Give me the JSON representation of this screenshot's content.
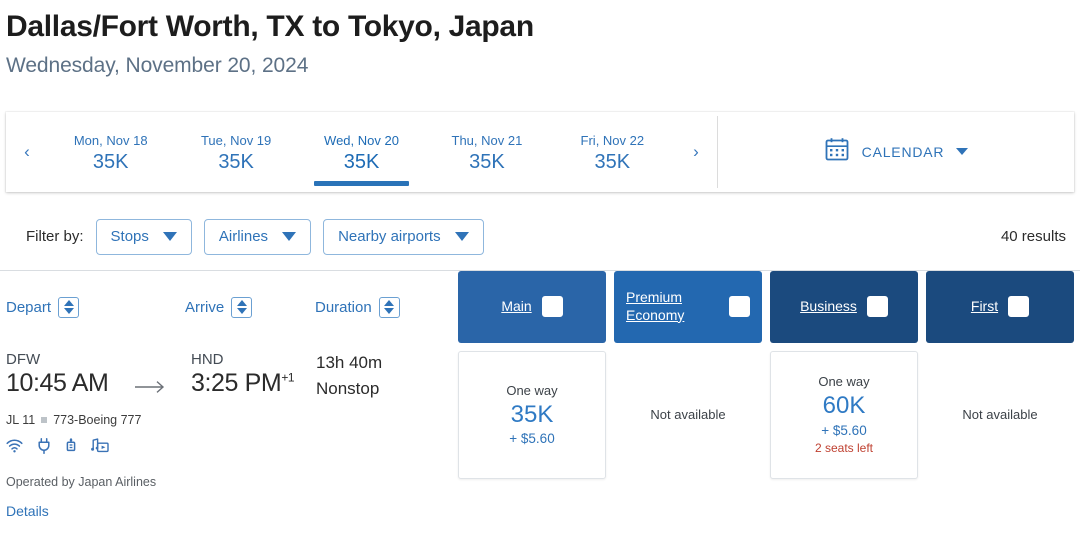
{
  "header": {
    "title": "Dallas/Fort Worth, TX to Tokyo, Japan",
    "subtitle": "Wednesday, November 20, 2024"
  },
  "datebar": {
    "prev_icon": "chevron-left-icon",
    "next_icon": "chevron-right-icon",
    "prev_glyph": "‹",
    "next_glyph": "›",
    "dates": [
      {
        "label": "Mon, Nov 18",
        "price": "35K",
        "selected": false
      },
      {
        "label": "Tue, Nov 19",
        "price": "35K",
        "selected": false
      },
      {
        "label": "Wed, Nov 20",
        "price": "35K",
        "selected": true
      },
      {
        "label": "Thu, Nov 21",
        "price": "35K",
        "selected": false
      },
      {
        "label": "Fri, Nov 22",
        "price": "35K",
        "selected": false
      }
    ],
    "calendar_label": "CALENDAR",
    "calendar_icon": "calendar-icon"
  },
  "filters": {
    "label": "Filter by:",
    "buttons": [
      {
        "label": "Stops"
      },
      {
        "label": "Airlines"
      },
      {
        "label": "Nearby airports"
      }
    ],
    "results": "40 results"
  },
  "columns": {
    "depart": "Depart",
    "arrive": "Arrive",
    "duration": "Duration"
  },
  "cabins": [
    {
      "label": "Main",
      "sort": "both",
      "color": "#2a65a8"
    },
    {
      "label": "Premium Economy",
      "sort": "both",
      "color": "#2368b0"
    },
    {
      "label": "Business",
      "sort": "down",
      "color": "#1b4a7e"
    },
    {
      "label": "First",
      "sort": "both",
      "color": "#1b4a7e"
    }
  ],
  "flight": {
    "depart_code": "DFW",
    "depart_time": "10:45 AM",
    "arrive_code": "HND",
    "arrive_time": "3:25 PM",
    "arrive_day_offset": "+1",
    "duration": "13h 40m",
    "stops": "Nonstop",
    "flight_number": "JL 11",
    "aircraft": "773-Boeing 777",
    "amenities": [
      "wifi-icon",
      "power-outlet-icon",
      "usb-port-icon",
      "entertainment-icon"
    ],
    "operated_by": "Operated by Japan Airlines",
    "details_link": "Details",
    "fares": [
      {
        "available": true,
        "way": "One way",
        "miles": "35K",
        "tax": "+ $5.60",
        "seats_left": ""
      },
      {
        "available": false,
        "unavailable_text": "Not available"
      },
      {
        "available": true,
        "way": "One way",
        "miles": "60K",
        "tax": "+ $5.60",
        "seats_left": "2 seats left"
      },
      {
        "available": false,
        "unavailable_text": "Not available"
      }
    ]
  },
  "colors": {
    "link_blue": "#2f73b8",
    "cabin_main": "#2a65a8",
    "cabin_premium": "#2368b0",
    "cabin_business": "#1b4a7e",
    "cabin_first": "#1b4a7e",
    "seats_left_red": "#bf4030",
    "subtitle_gray": "#5d7186"
  }
}
